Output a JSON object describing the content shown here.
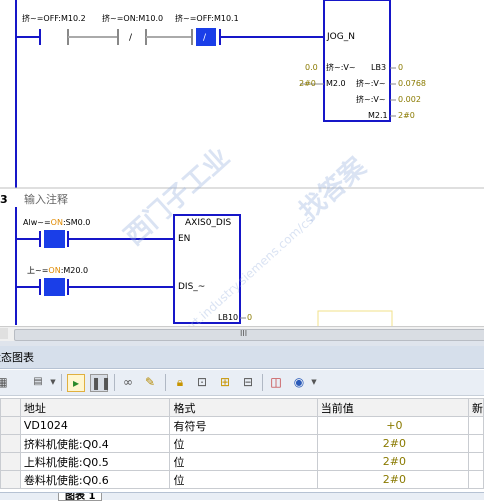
{
  "network1": {
    "contact1_label": "挤~=OFF:M10.2",
    "contact2_label": "挤~=ON:M10.0",
    "contact3_label": "挤~=OFF:M10.1",
    "contact2_symbol": "/",
    "contact3_symbol": "/",
    "box_input_jog": "JOG_N",
    "row1_left_value": "0.0",
    "row1_left_text": "挤~:V~",
    "row1_right_pin": "LB3",
    "row1_right_value": "0",
    "row2_left_value": "2#0",
    "row2_left_pin": "M2.0",
    "row2_right_text": "挤~:V~",
    "row2_right_value": "0.0768",
    "row3_right_text": "挤~:V~",
    "row3_right_value": "0.002",
    "row4_right_pin": "M2.1",
    "row4_right_value": "2#0"
  },
  "network3": {
    "number": "3",
    "comment": "输入注释",
    "contact1_label_prefix": "Alw~=",
    "contact1_label_state": "ON",
    "contact1_label_addr": ":SM0.0",
    "contact2_label_prefix": "上~=",
    "contact2_label_state": "ON",
    "contact2_label_addr": ":M20.0",
    "box_title": "AXIS0_DIS",
    "pin_en": "EN",
    "pin_dis": "DIS_~",
    "out_pin": "LB10",
    "out_value": "0"
  },
  "scrollbar": {
    "grip": "III"
  },
  "panel": {
    "title": "状态图表"
  },
  "watermark": {
    "line1": "西门子工业",
    "line2": "找答案",
    "line3": "support.industry.siemens.com/cs"
  },
  "table": {
    "headers": [
      "地址",
      "格式",
      "当前值",
      "新"
    ],
    "rows": [
      {
        "address": "VD1024",
        "format": "有符号",
        "value": "+0"
      },
      {
        "address": "挤料机使能:Q0.4",
        "format": "位",
        "value": "2#0"
      },
      {
        "address": "上料机使能:Q0.5",
        "format": "位",
        "value": "2#0"
      },
      {
        "address": "卷料机使能:Q0.6",
        "format": "位",
        "value": "2#0"
      }
    ]
  },
  "bottom_tab": {
    "label": "图表 1"
  },
  "colors": {
    "ladder_blue": "#1616c8",
    "active_contact": "#1a3ee8",
    "value_olive": "#8a7a00",
    "state_orange": "#e08a00"
  }
}
